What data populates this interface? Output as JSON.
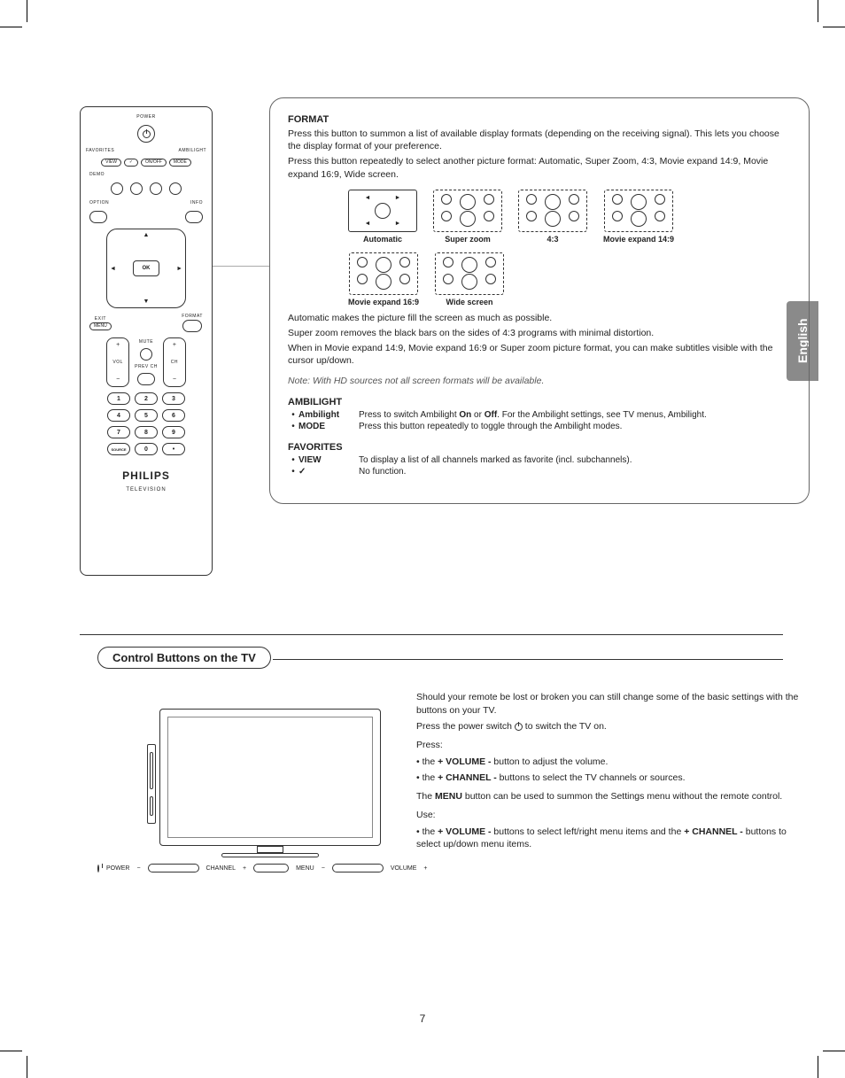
{
  "language_tab": "English",
  "page_number": "7",
  "remote": {
    "power": "POWER",
    "favorites": "FAVORITES",
    "ambilight": "AMBILIGHT",
    "view": "VIEW",
    "check": "✓",
    "onoff": "ON/OFF",
    "mode": "MODE",
    "demo": "DEMO",
    "option": "OPTION",
    "info": "INFO",
    "ok": "OK",
    "exit": "EXIT",
    "format": "FORMAT",
    "menu": "MENU",
    "mute": "MUTE",
    "vol": "VOL",
    "prevch": "PREV CH",
    "ch": "CH",
    "source": "SOURCE",
    "brand": "PHILIPS",
    "brand_sub": "TELEVISION"
  },
  "format_section": {
    "title": "FORMAT",
    "p1": "Press this button to summon a list of available display formats (depending on the receiving signal). This lets you choose the display format of your preference.",
    "p2": "Press this button repeatedly to select another picture format: Automatic, Super Zoom, 4:3, Movie expand 14:9, Movie expand 16:9, Wide screen.",
    "labels": {
      "automatic": "Automatic",
      "super_zoom": "Super zoom",
      "ratio43": "4:3",
      "movie149": "Movie expand 14:9",
      "movie169": "Movie expand 16:9",
      "wide": "Wide screen"
    },
    "p3": "Automatic makes the picture fill the screen as much as possible.",
    "p4": "Super zoom removes the black bars on the sides of 4:3 programs with minimal distortion.",
    "p5": "When in Movie expand 14:9, Movie expand 16:9 or Super zoom picture format, you can make subtitles visible with the cursor up/down.",
    "note": "Note: With HD sources not all screen formats will be available."
  },
  "ambilight_section": {
    "title": "AMBILIGHT",
    "row1_label": "Ambilight",
    "row1_text_a": "Press to switch Ambilight ",
    "row1_on": "On",
    "row1_or": " or ",
    "row1_off": "Off",
    "row1_text_b": ". For the Ambilight settings, see TV menus, Ambilight.",
    "row2_label": "MODE",
    "row2_text": "Press this button repeatedly to toggle through the Ambilight modes."
  },
  "favorites_section": {
    "title": "FAVORITES",
    "row1_label": "VIEW",
    "row1_text": "To display a list of all channels marked as favorite (incl. subchannels).",
    "row2_label": "✓",
    "row2_text": "No function."
  },
  "control_section": {
    "heading": "Control Buttons on the TV",
    "p1": "Should your remote be lost or broken you can still change some of the basic settings with the buttons on your TV.",
    "p2a": "Press the power switch ",
    "p2b": " to switch the TV on.",
    "press": "Press:",
    "b1a": "• the ",
    "b1b": "+ VOLUME -",
    "b1c": " button to adjust the volume.",
    "b2a": "• the ",
    "b2b": "+ CHANNEL -",
    "b2c": " buttons to select the TV channels or sources.",
    "p3a": "The ",
    "p3b": "MENU",
    "p3c": " button can be used to summon the Settings menu without the remote control.",
    "use": "Use:",
    "b3a": "• the ",
    "b3b": "+ VOLUME -",
    "b3c": "  buttons to select left/right menu items and the ",
    "b3d": "+ CHANNEL -",
    "b3e": " buttons to select up/down menu items.",
    "tv_labels": {
      "power": "POWER",
      "channel": "CHANNEL",
      "menu": "MENU",
      "volume": "VOLUME"
    }
  }
}
